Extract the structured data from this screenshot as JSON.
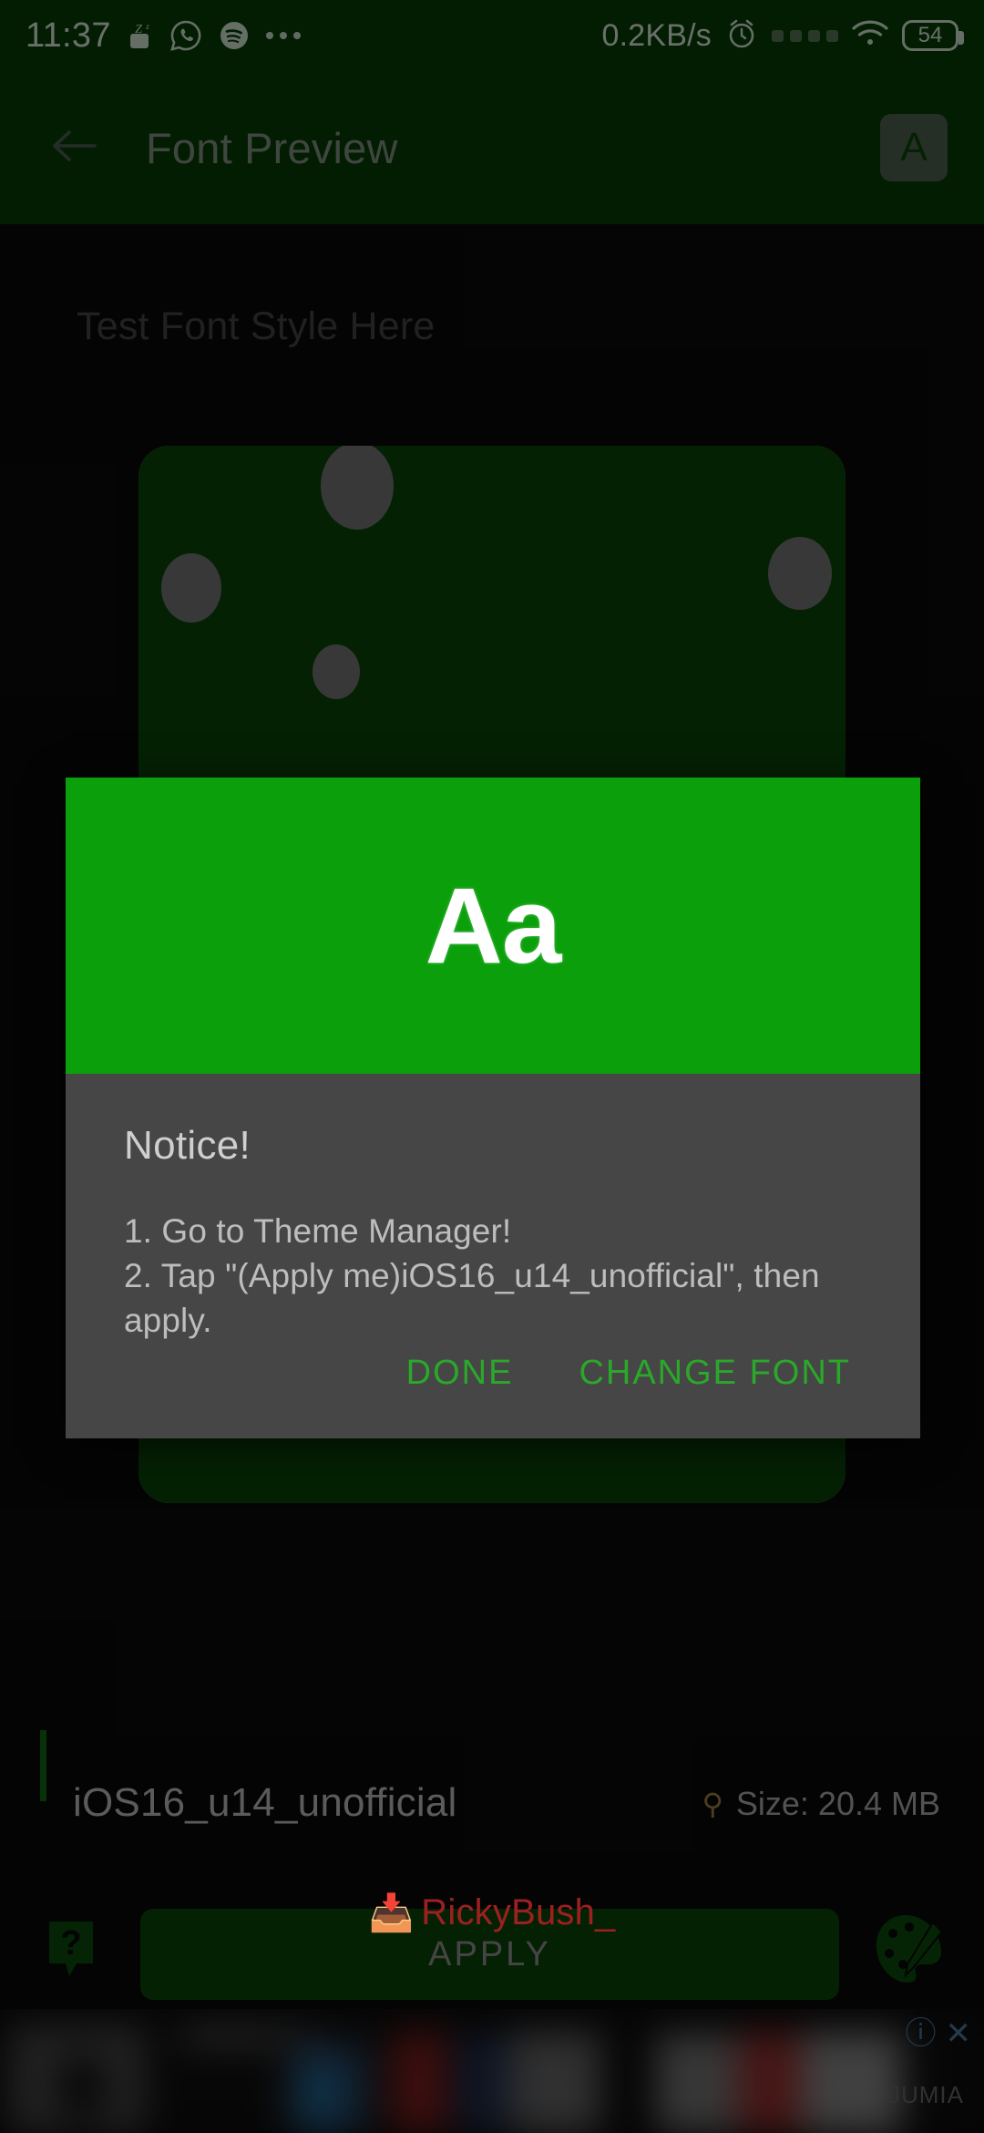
{
  "status_bar": {
    "time": "11:37",
    "network_speed": "0.2KB/s",
    "battery_level": "54",
    "icons": [
      "zzz-icon",
      "whatsapp-icon",
      "spotify-icon",
      "more-dots-icon",
      "alarm-icon",
      "signal-dots-icon",
      "wifi-icon",
      "battery-icon"
    ]
  },
  "app_bar": {
    "title": "Font Preview",
    "back_icon": "back-arrow-icon",
    "font_size_label": "A"
  },
  "main": {
    "test_text": "Test Font Style Here",
    "font_name": "iOS16_u14_unofficial",
    "font_size_info": "Size: 20.4 MB",
    "size_icon": "size-icon",
    "apply_label": "APPLY",
    "help_icon": "help-question-icon",
    "palette_icon": "palette-icon"
  },
  "dialog": {
    "preview_glyph": "Aa",
    "title": "Notice!",
    "lines": [
      "1. Go to Theme Manager!",
      "2. Tap \"(Apply me)iOS16_u14_unofficial\", then apply."
    ],
    "done_label": "DONE",
    "change_font_label": "CHANGE FONT",
    "header_color": "#0ba00b",
    "body_color": "#464646",
    "action_color": "#2aa82a"
  },
  "ad": {
    "info_icon": "ⓘ",
    "close_icon": "✕",
    "brand": "JUMIA"
  },
  "watermark": {
    "icon": "📥",
    "text": "RickyBush_"
  }
}
